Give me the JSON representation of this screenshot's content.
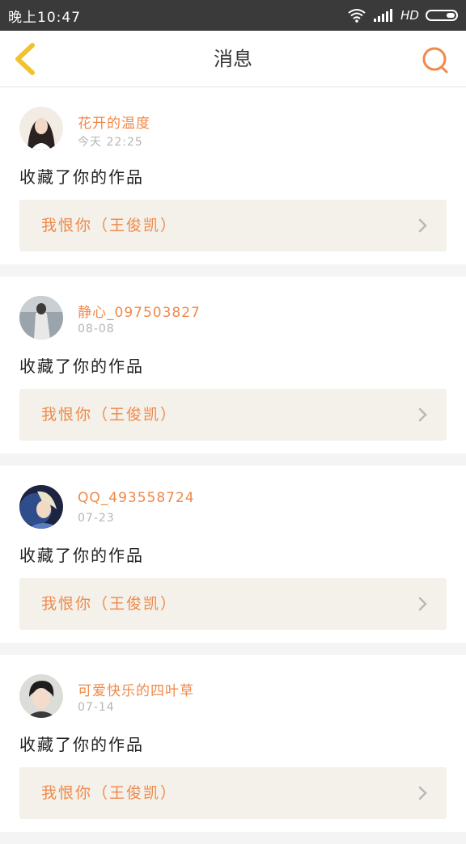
{
  "status_bar": {
    "time": "晚上10:47",
    "network": "HD"
  },
  "header": {
    "title": "消息",
    "back_icon": "chevron-left-icon",
    "search_icon": "search-icon"
  },
  "colors": {
    "accent": "#f0894a",
    "back_arrow": "#f2c12e",
    "card_box": "#f3f1ea"
  },
  "messages": [
    {
      "username": "花开的温度",
      "time": "今天 22:25",
      "action": "收藏了你的作品",
      "work_title": "我恨你（王俊凯）"
    },
    {
      "username": "静心_097503827",
      "time": "08-08",
      "action": "收藏了你的作品",
      "work_title": "我恨你（王俊凯）"
    },
    {
      "username": "QQ_493558724",
      "time": "07-23",
      "action": "收藏了你的作品",
      "work_title": "我恨你（王俊凯）"
    },
    {
      "username": "可爱快乐的四叶草",
      "time": "07-14",
      "action": "收藏了你的作品",
      "work_title": "我恨你（王俊凯）"
    }
  ]
}
